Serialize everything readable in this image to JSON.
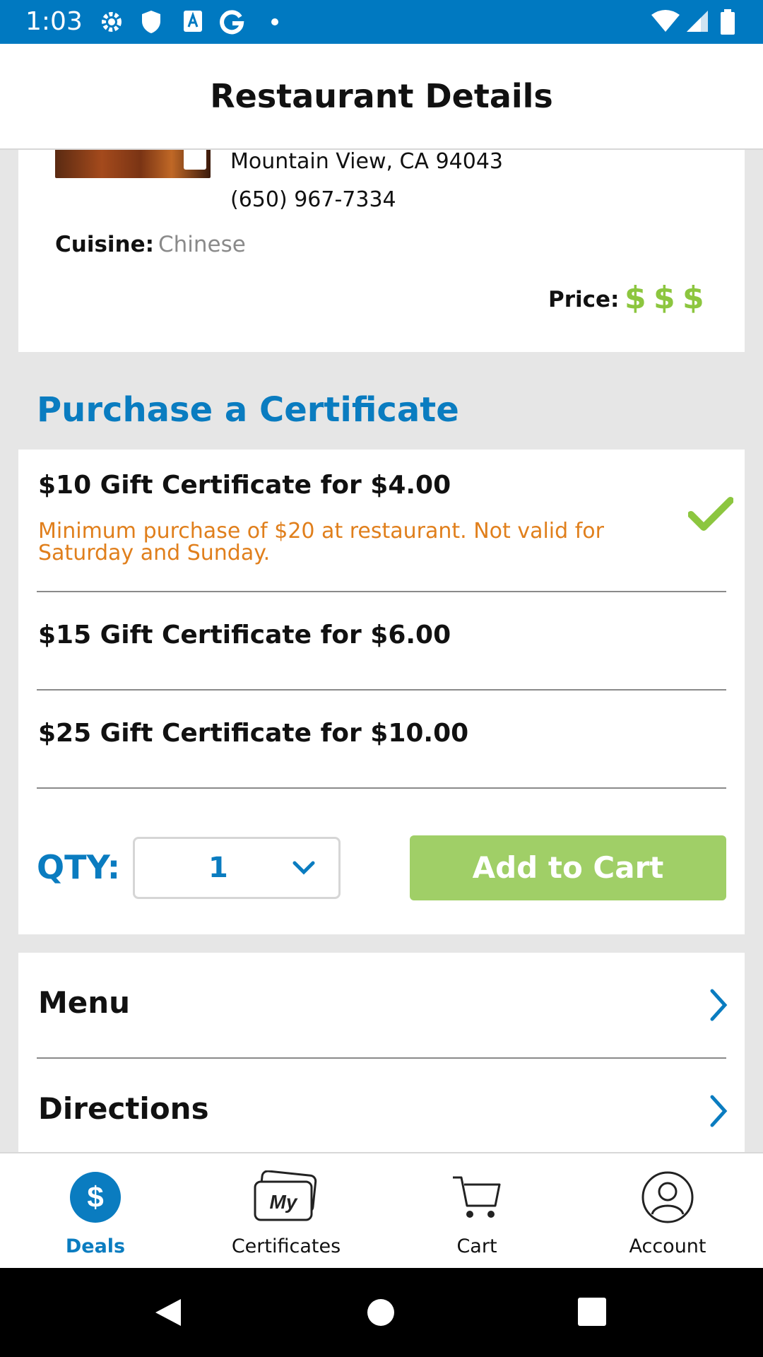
{
  "status_bar": {
    "time": "1:03"
  },
  "app_bar": {
    "title": "Restaurant Details"
  },
  "restaurant": {
    "address_line": "Mountain View, CA 94043",
    "phone": "(650) 967-7334",
    "cuisine_label": "Cuisine:",
    "cuisine_value": "Chinese",
    "price_label": "Price:",
    "price_symbols": [
      "$",
      "$",
      "$"
    ]
  },
  "purchase": {
    "section_title": "Purchase a Certificate",
    "certificates": [
      {
        "title": "$10 Gift Certificate for $4.00",
        "note": "Minimum purchase of $20 at restaurant. Not valid for Saturday and Sunday.",
        "selected": true
      },
      {
        "title": "$15 Gift Certificate for $6.00",
        "selected": false
      },
      {
        "title": "$25 Gift Certificate for $10.00",
        "selected": false
      }
    ],
    "qty_label": "QTY:",
    "qty_value": "1",
    "add_button": "Add to Cart"
  },
  "links": [
    {
      "label": "Menu"
    },
    {
      "label": "Directions"
    }
  ],
  "bottom_nav": {
    "tabs": [
      {
        "label": "Deals",
        "icon": "dollar-circle-icon",
        "active": true
      },
      {
        "label": "Certificates",
        "icon": "my-certificates-icon",
        "active": false
      },
      {
        "label": "Cart",
        "icon": "cart-icon",
        "active": false
      },
      {
        "label": "Account",
        "icon": "account-icon",
        "active": false
      }
    ]
  },
  "colors": {
    "primary_blue": "#0079c1",
    "accent_green": "#8cc63f",
    "note_orange": "#e07f1c"
  }
}
